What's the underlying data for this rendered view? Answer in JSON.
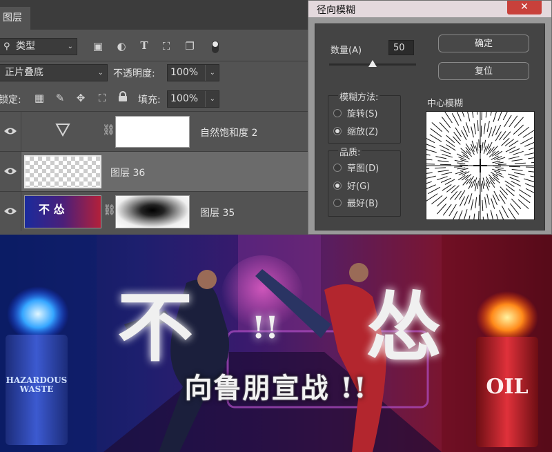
{
  "layers_panel": {
    "tab": "图层",
    "filter": {
      "label": "类型"
    },
    "blend_mode": "正片叠底",
    "opacity": {
      "label": "不透明度:",
      "value": "100%"
    },
    "lock": {
      "label": "锁定:"
    },
    "fill": {
      "label": "填充:",
      "value": "100%"
    },
    "layers": [
      {
        "name": "自然饱和度 2"
      },
      {
        "name": "图层 36"
      },
      {
        "name": "图层 35"
      }
    ]
  },
  "dialog": {
    "title": "径向模糊",
    "close": "✕",
    "amount_label": "数量(A)",
    "amount_value": "50",
    "amount_fraction": 0.5,
    "ok": "确定",
    "reset": "复位",
    "method": {
      "label": "模糊方法:",
      "options": [
        "旋转(S)",
        "缩放(Z)"
      ],
      "selected": "缩放(Z)"
    },
    "quality": {
      "label": "品质:",
      "options": [
        "草图(D)",
        "好(G)",
        "最好(B)"
      ],
      "selected": "好(G)"
    },
    "center_label": "中心模糊"
  },
  "banner": {
    "title": "向鲁朋宣战 !!",
    "big_left": "不",
    "big_mid": "!!",
    "big_right": "怂",
    "barrel_left": "HAZARDOUS\nWASTE",
    "barrel_right": "OIL",
    "thumb_text": "不 怂"
  },
  "colors": {
    "panel_bg": "#535353",
    "dark_bg": "#3c3c3c",
    "selected_row": "#6b6b6b",
    "dialog_body": "#444444",
    "close_red": "#c8413b"
  }
}
